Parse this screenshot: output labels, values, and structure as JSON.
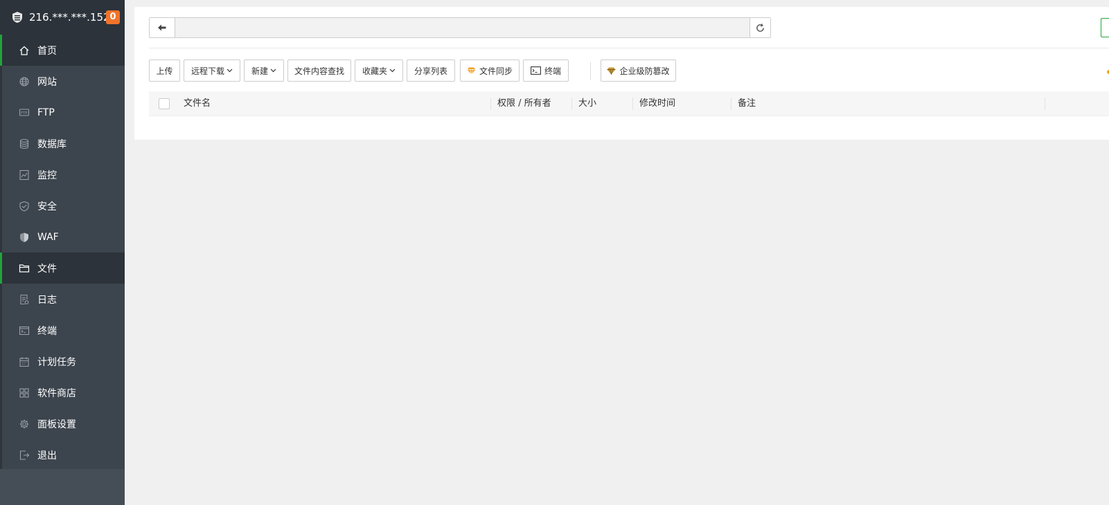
{
  "server": {
    "ip": "216.***.***.152",
    "badge": "0"
  },
  "sidebar": {
    "items": [
      {
        "label": "首页",
        "icon": "home-icon"
      },
      {
        "label": "网站",
        "icon": "globe-icon"
      },
      {
        "label": "FTP",
        "icon": "ftp-icon"
      },
      {
        "label": "数据库",
        "icon": "database-icon"
      },
      {
        "label": "监控",
        "icon": "monitor-icon"
      },
      {
        "label": "安全",
        "icon": "shield-check-icon"
      },
      {
        "label": "WAF",
        "icon": "shield-icon"
      },
      {
        "label": "文件",
        "icon": "folder-icon"
      },
      {
        "label": "日志",
        "icon": "log-icon"
      },
      {
        "label": "终端",
        "icon": "terminal-icon"
      },
      {
        "label": "计划任务",
        "icon": "calendar-icon"
      },
      {
        "label": "软件商店",
        "icon": "apps-icon"
      },
      {
        "label": "面板设置",
        "icon": "gear-icon"
      },
      {
        "label": "退出",
        "icon": "logout-icon"
      }
    ]
  },
  "path": {
    "value": ""
  },
  "toolbar": {
    "upload": "上传",
    "remote_download": "远程下载",
    "new": "新建",
    "content_search": "文件内容查找",
    "favorites": "收藏夹",
    "share_list": "分享列表",
    "file_sync": "文件同步",
    "terminal": "终端",
    "tamper_proof": "企业级防篡改"
  },
  "table": {
    "columns": [
      "文件名",
      "权限 / 所有者",
      "大小",
      "修改时间",
      "备注"
    ]
  },
  "colors": {
    "accent": "#20a53a",
    "badge": "#f0732a",
    "sidebar": "#3c444d",
    "gem": "#f0a020"
  }
}
